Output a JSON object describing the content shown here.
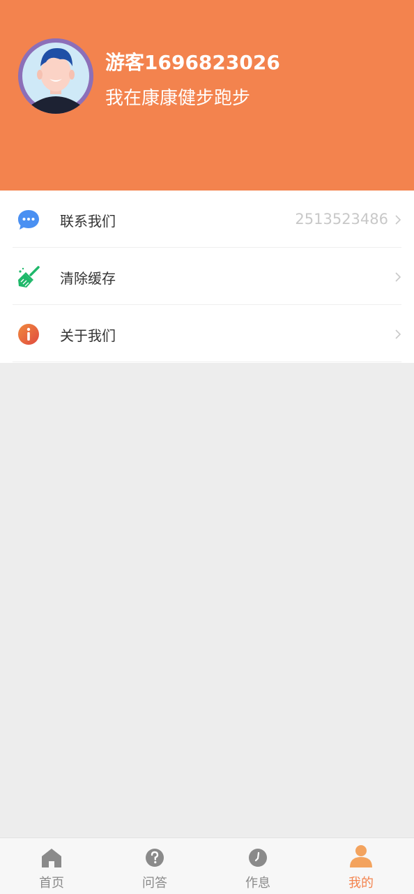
{
  "header": {
    "username": "游客1696823026",
    "subtitle": "我在康康健步跑步",
    "background_color": "#f3834e"
  },
  "menu": [
    {
      "label": "联系我们",
      "value": "2513523486",
      "icon": "chat-bubble-icon",
      "icon_color": "#4a90f2"
    },
    {
      "label": "清除缓存",
      "value": "",
      "icon": "broom-icon",
      "icon_color": "#1fb86a"
    },
    {
      "label": "关于我们",
      "value": "",
      "icon": "info-icon",
      "icon_color": "#e8653f"
    }
  ],
  "tabbar": {
    "tabs": [
      {
        "label": "首页",
        "icon": "home-icon"
      },
      {
        "label": "问答",
        "icon": "question-icon"
      },
      {
        "label": "作息",
        "icon": "clock-icon"
      },
      {
        "label": "我的",
        "icon": "user-icon",
        "active": true
      }
    ],
    "active_color": "#f3834e",
    "inactive_color": "#8a8a8a"
  }
}
